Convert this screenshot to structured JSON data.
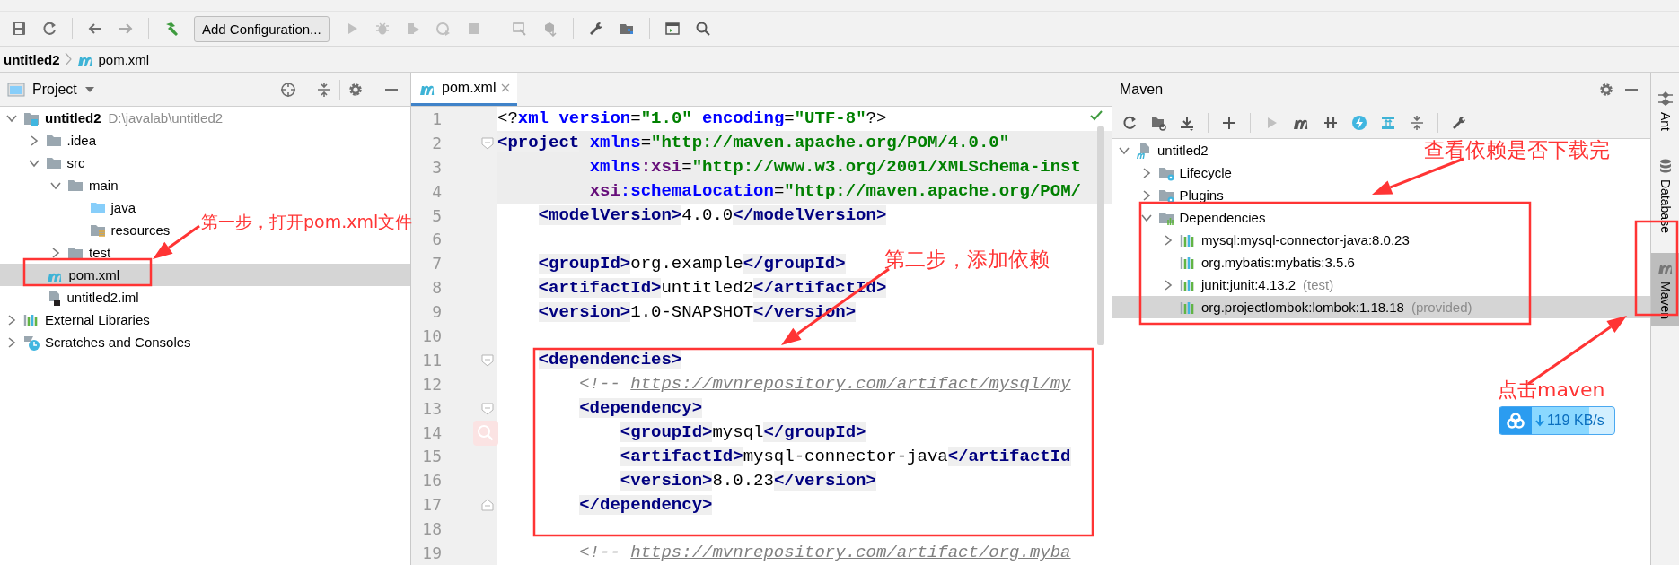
{
  "toolbar": {
    "configuration_button": "Add Configuration..."
  },
  "breadcrumb": [
    "untitled2",
    "pom.xml"
  ],
  "project_panel": {
    "title": "Project",
    "tree": [
      {
        "label": "untitled2",
        "detail": "D:\\javalab\\untitled2",
        "kind": "module",
        "expanded": true,
        "selected": false,
        "children": [
          {
            "label": ".idea",
            "kind": "folder",
            "expanded": false,
            "selected": false
          },
          {
            "label": "src",
            "kind": "folder",
            "expanded": true,
            "selected": false,
            "children": [
              {
                "label": "main",
                "kind": "folder",
                "expanded": true,
                "selected": false,
                "children": [
                  {
                    "label": "java",
                    "kind": "source",
                    "selected": false
                  },
                  {
                    "label": "resources",
                    "kind": "resources",
                    "selected": false
                  }
                ]
              },
              {
                "label": "test",
                "kind": "folder",
                "expanded": false,
                "selected": false
              }
            ]
          },
          {
            "label": "pom.xml",
            "kind": "maven",
            "selected": true
          },
          {
            "label": "untitled2.iml",
            "kind": "iml",
            "selected": false
          }
        ]
      },
      {
        "label": "External Libraries",
        "kind": "library",
        "expanded": false,
        "selected": false
      },
      {
        "label": "Scratches and Consoles",
        "kind": "scratches",
        "expanded": false,
        "selected": false
      }
    ]
  },
  "editor": {
    "tabs": [
      {
        "label": "pom.xml",
        "selected": true
      }
    ],
    "lines": [
      {
        "number": "1",
        "highlighted": false,
        "tokens": [
          {
            "kind": "pi",
            "text": "<?"
          },
          {
            "kind": "attr",
            "text": "xml"
          },
          {
            "kind": "attr",
            "text": " version"
          },
          {
            "kind": "plain",
            "text": "="
          },
          {
            "kind": "value",
            "text": "\"1.0\""
          },
          {
            "kind": "attr",
            "text": " encoding"
          },
          {
            "kind": "plain",
            "text": "="
          },
          {
            "kind": "value",
            "text": "\"UTF-8\""
          },
          {
            "kind": "pi",
            "text": "?>"
          }
        ]
      },
      {
        "number": "2",
        "highlighted": true,
        "fold_start": true,
        "tokens": [
          {
            "kind": "tag",
            "text": "<project"
          },
          {
            "kind": "attr",
            "text": " xmlns"
          },
          {
            "kind": "plain",
            "text": "="
          },
          {
            "kind": "value",
            "text": "\"http://maven.apache.org/POM/4.0.0\""
          }
        ]
      },
      {
        "number": "3",
        "highlighted": true,
        "tokens": [
          {
            "kind": "attr",
            "text": "         xmlns"
          },
          {
            "kind": "ns",
            "text": ":xsi"
          },
          {
            "kind": "plain",
            "text": "="
          },
          {
            "kind": "value",
            "text": "\"http://www.w3.org/2001/XMLSchema-inst"
          }
        ]
      },
      {
        "number": "4",
        "highlighted": true,
        "tokens": [
          {
            "kind": "ns",
            "text": "         xsi"
          },
          {
            "kind": "attr",
            "text": ":schemaLocation"
          },
          {
            "kind": "plain",
            "text": "="
          },
          {
            "kind": "value",
            "text": "\"http://maven.apache.org/POM/"
          }
        ]
      },
      {
        "number": "5",
        "highlighted": false,
        "tokens": [
          {
            "kind": "tag",
            "text": "    <modelVersion>"
          },
          {
            "kind": "plain",
            "text": "4.0.0"
          },
          {
            "kind": "tag",
            "text": "</modelVersion>"
          }
        ]
      },
      {
        "number": "6",
        "highlighted": false
      },
      {
        "number": "7",
        "highlighted": false,
        "tokens": [
          {
            "kind": "tag",
            "text": "    <groupId>"
          },
          {
            "kind": "plain",
            "text": "org.example"
          },
          {
            "kind": "tag",
            "text": "</groupId>"
          }
        ]
      },
      {
        "number": "8",
        "highlighted": false,
        "tokens": [
          {
            "kind": "tag",
            "text": "    <artifactId>"
          },
          {
            "kind": "plain",
            "text": "untitled2"
          },
          {
            "kind": "tag",
            "text": "</artifactId>"
          }
        ]
      },
      {
        "number": "9",
        "highlighted": false,
        "tokens": [
          {
            "kind": "tag",
            "text": "    <version>"
          },
          {
            "kind": "plain",
            "text": "1.0-SNAPSHOT"
          },
          {
            "kind": "tag",
            "text": "</version>"
          }
        ]
      },
      {
        "number": "10",
        "highlighted": false
      },
      {
        "number": "11",
        "highlighted": false,
        "fold_start": true,
        "tokens": [
          {
            "kind": "tag",
            "text": "    <dependencies>"
          }
        ]
      },
      {
        "number": "12",
        "highlighted": false,
        "tokens": [
          {
            "kind": "comment",
            "text": "        <!--"
          },
          {
            "kind": "link",
            "text": " https://mvnrepository.com/artifact/mysql/my"
          }
        ]
      },
      {
        "number": "13",
        "highlighted": false,
        "fold_start": true,
        "tokens": [
          {
            "kind": "tag",
            "text": "        <dependency>"
          }
        ]
      },
      {
        "number": "14",
        "highlighted": false,
        "tokens": [
          {
            "kind": "tag",
            "text": "            <groupId>"
          },
          {
            "kind": "plain",
            "text": "mysql"
          },
          {
            "kind": "tag",
            "text": "</groupId>"
          }
        ]
      },
      {
        "number": "15",
        "highlighted": false,
        "tokens": [
          {
            "kind": "tag",
            "text": "            <artifactId>"
          },
          {
            "kind": "plain",
            "text": "mysql-connector-java"
          },
          {
            "kind": "tag",
            "text": "</artifactId"
          }
        ]
      },
      {
        "number": "16",
        "highlighted": false,
        "tokens": [
          {
            "kind": "tag",
            "text": "            <version>"
          },
          {
            "kind": "plain",
            "text": "8.0.23"
          },
          {
            "kind": "tag",
            "text": "</version>"
          }
        ]
      },
      {
        "number": "17",
        "highlighted": false,
        "fold_end": true,
        "tokens": [
          {
            "kind": "tag",
            "text": "        </dependency>"
          }
        ]
      },
      {
        "number": "18",
        "highlighted": false
      },
      {
        "number": "19",
        "highlighted": false,
        "tokens": [
          {
            "kind": "comment",
            "text": "        <!--"
          },
          {
            "kind": "link",
            "text": " https://mvnrepository.com/artifact/org.myba"
          }
        ]
      }
    ]
  },
  "maven_panel": {
    "title": "Maven",
    "tree": [
      {
        "label": "untitled2",
        "kind": "maven-module",
        "expanded": true,
        "selected": false,
        "children": [
          {
            "label": "Lifecycle",
            "kind": "config",
            "expanded": false,
            "selected": false
          },
          {
            "label": "Plugins",
            "kind": "config",
            "expanded": false,
            "selected": false
          },
          {
            "label": "Dependencies",
            "kind": "dependencies",
            "expanded": true,
            "selected": false,
            "children": [
              {
                "label": "mysql:mysql-connector-java:8.0.23",
                "kind": "library",
                "expanded": false,
                "selected": false
              },
              {
                "label": "org.mybatis:mybatis:3.5.6",
                "kind": "library",
                "selected": false
              },
              {
                "label": "junit:junit:4.13.2",
                "detail": "(test)",
                "kind": "library",
                "expanded": false,
                "selected": false
              },
              {
                "label": "org.projectlombok:lombok:1.18.18",
                "detail": "(provided)",
                "kind": "library",
                "selected": true
              }
            ]
          }
        ]
      }
    ]
  },
  "side_tabs": [
    {
      "label": "Ant",
      "kind": "ant",
      "selected": false
    },
    {
      "label": "Database",
      "kind": "database",
      "selected": false
    },
    {
      "label": "Maven",
      "kind": "maven",
      "selected": true
    }
  ],
  "annotations": [
    {
      "text": "第一步，打开pom.xml文件"
    },
    {
      "text": "第二步，添加依赖"
    },
    {
      "text": "查看依赖是否下载完"
    },
    {
      "text": "点击maven"
    }
  ],
  "download_badge": {
    "speed": "119 KB/s"
  }
}
